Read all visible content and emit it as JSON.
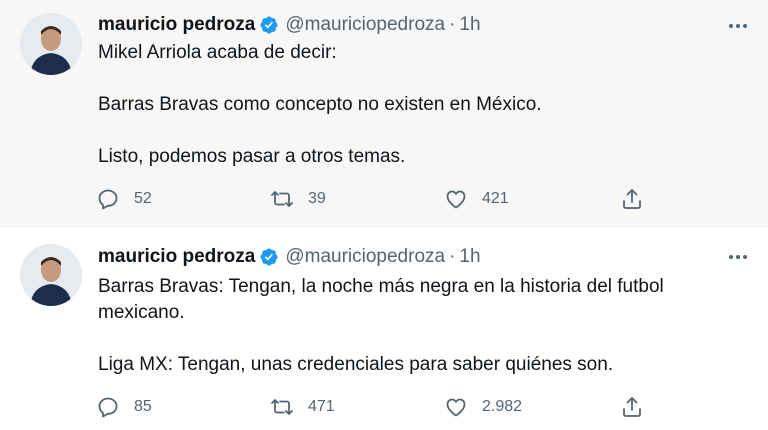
{
  "tweets": [
    {
      "author_name": "mauricio pedroza",
      "handle": "@mauriciopedroza",
      "separator": "·",
      "time": "1h",
      "paragraphs": [
        "Mikel Arriola acaba de decir:",
        "Barras Bravas como concepto no existen en México.",
        "Listo, podemos pasar a otros temas."
      ],
      "replies": "52",
      "retweets": "39",
      "likes": "421"
    },
    {
      "author_name": "mauricio pedroza",
      "handle": "@mauriciopedroza",
      "separator": "·",
      "time": "1h",
      "paragraphs": [
        "Barras Bravas: Tengan, la noche más negra en la historia del futbol mexicano.",
        "Liga MX: Tengan, unas credenciales para saber quiénes son."
      ],
      "replies": "85",
      "retweets": "471",
      "likes": "2.982"
    }
  ],
  "icons": {
    "verified": "verified-badge-icon",
    "more": "more-options-icon",
    "reply": "reply-icon",
    "retweet": "retweet-icon",
    "like": "like-heart-icon",
    "share": "share-icon"
  },
  "colors": {
    "verified_blue": "#1d9bf0",
    "text": "#0f1419",
    "secondary_text": "#536471",
    "highlight_background": "#f7f7f7"
  }
}
